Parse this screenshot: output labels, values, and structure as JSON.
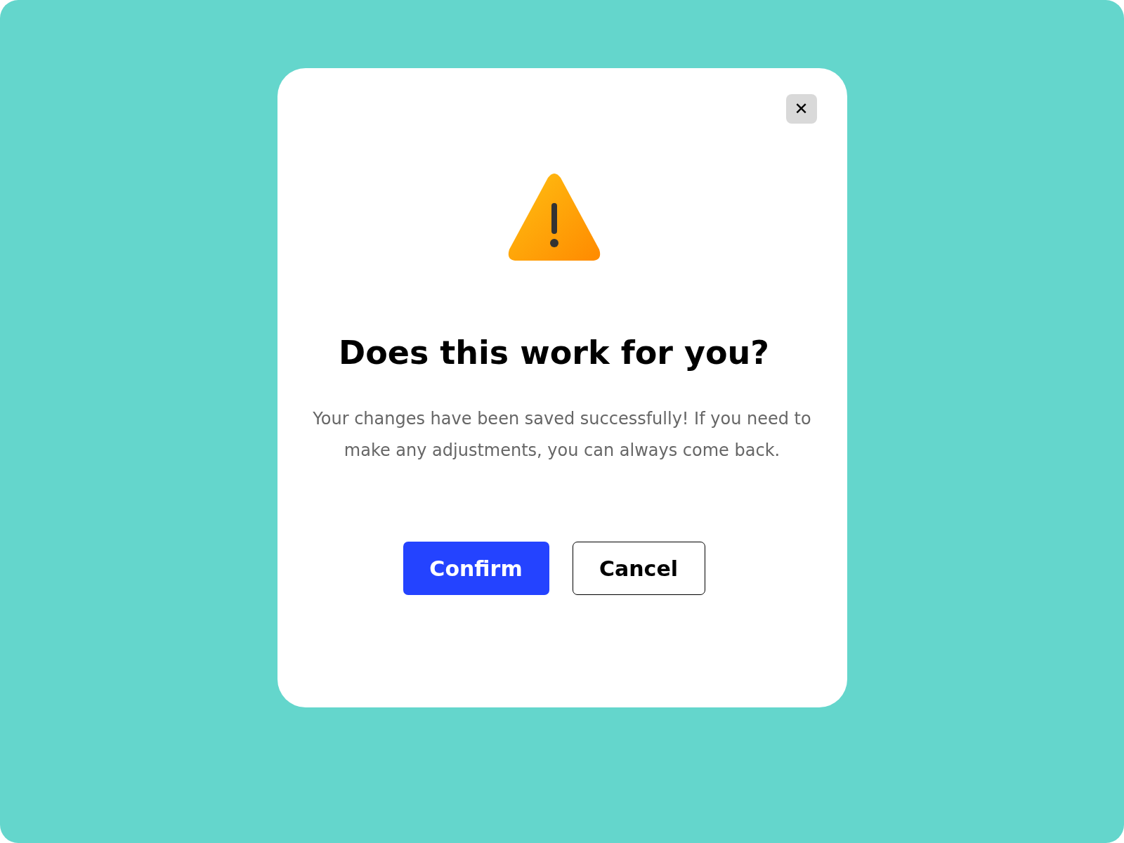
{
  "dialog": {
    "close_label": "✕",
    "title": "Does this work for you?",
    "message": "Your changes have been saved successfully! If you need to make any adjustments, you can always come back.",
    "buttons": [
      {
        "label": "Confirm",
        "kind": "primary"
      },
      {
        "label": "Cancel",
        "kind": "secondary"
      }
    ]
  }
}
